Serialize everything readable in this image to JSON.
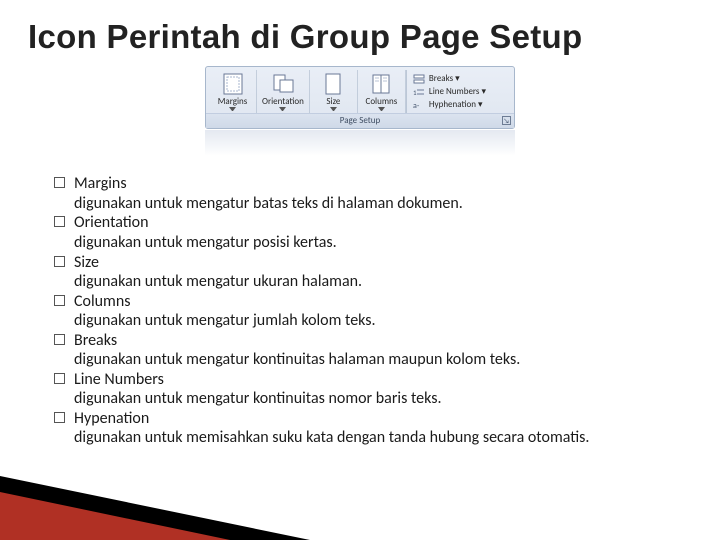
{
  "title": "Icon Perintah di Group Page Setup",
  "ribbon": {
    "buttons": [
      {
        "label": "Margins"
      },
      {
        "label": "Orientation"
      },
      {
        "label": "Size"
      },
      {
        "label": "Columns"
      }
    ],
    "side_items": [
      {
        "label": "Breaks ▾"
      },
      {
        "label": "Line Numbers ▾"
      },
      {
        "label": "Hyphenation ▾"
      }
    ],
    "group_label": "Page Setup"
  },
  "items": [
    {
      "term": "Margins",
      "desc": "digunakan untuk mengatur batas teks di halaman dokumen."
    },
    {
      "term": "Orientation",
      "desc": "digunakan untuk mengatur posisi kertas."
    },
    {
      "term": "Size",
      "desc": "digunakan untuk mengatur ukuran halaman."
    },
    {
      "term": "Columns",
      "desc": "digunakan untuk mengatur jumlah kolom teks."
    },
    {
      "term": "Breaks",
      "desc": "digunakan untuk mengatur kontinuitas halaman maupun kolom teks."
    },
    {
      "term": "Line Numbers",
      "desc": "digunakan untuk mengatur kontinuitas nomor baris teks."
    },
    {
      "term": "Hypenation",
      "desc": "digunakan untuk memisahkan suku kata dengan tanda hubung secara otomatis."
    }
  ]
}
